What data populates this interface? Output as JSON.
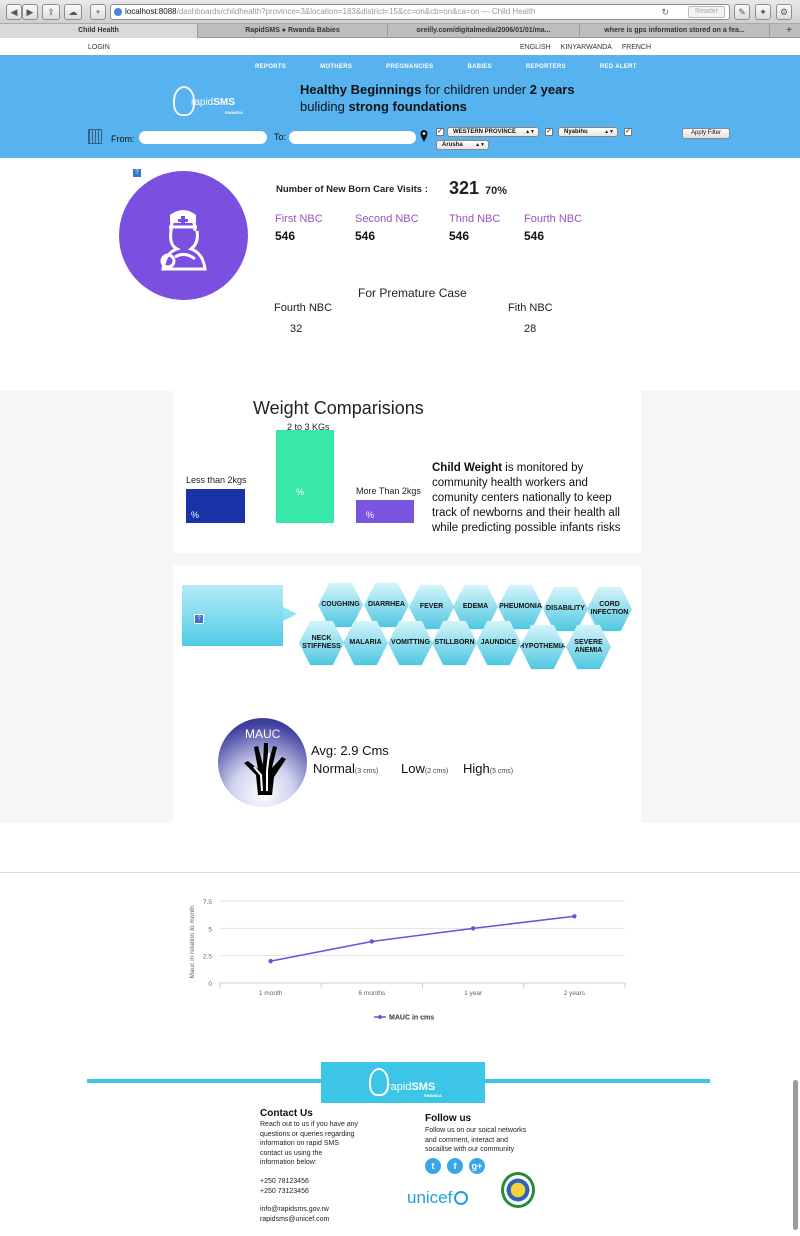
{
  "browser": {
    "url_host": "localhost:8088",
    "url_rest": "/dashboards/childhealth?province=3&location=183&district=15&cc=on&cb=on&ca=on",
    "url_suffix": " — Child Health",
    "reader_label": "Reader",
    "tabs": [
      {
        "label": "Child Health"
      },
      {
        "label": "RapidSMS ● Rwanda Babies"
      },
      {
        "label": "oreilly.com/digitalmedia/2006/01/01/ma..."
      },
      {
        "label": "where is gps information stored on a fea..."
      }
    ]
  },
  "topbar": {
    "login": "LOGIN",
    "languages": [
      "ENGLISH",
      "KINYARWANDA",
      "FRENCH"
    ]
  },
  "nav": {
    "items": [
      "REPORTS",
      "MOTHERS",
      "PREGNANCIES",
      "BABIES",
      "REPORTERS",
      "RED ALERT"
    ]
  },
  "logo": {
    "rapid": "rapid",
    "sms": "SMS",
    "country": "RWANDA"
  },
  "tagline": {
    "line1_bold": "Healthy Beginnings",
    "line1_mid": " for children under ",
    "line1_bold2": "2 years",
    "line2_plain": "buliding ",
    "line2_bold": "strong foundations"
  },
  "filters": {
    "from_label": "From:",
    "to_label": "To:",
    "province": "WESTERN PROVINCE",
    "district": "Nyabihu",
    "sector": "Arusha",
    "apply": "Apply Filter"
  },
  "help_label": "?",
  "nbc": {
    "title": "Number of New Born Care Visits :",
    "count": "321",
    "percent": "70%",
    "visits": [
      {
        "name": "First NBC",
        "value": "546"
      },
      {
        "name": "Second NBC",
        "value": "546"
      },
      {
        "name": "Thrid NBC",
        "value": "546"
      },
      {
        "name": "Fourth NBC",
        "value": "546"
      }
    ],
    "premature_title": "For Premature Case",
    "premature": [
      {
        "name": "Fourth NBC",
        "value": "32"
      },
      {
        "name": "Fith NBC",
        "value": "28"
      }
    ]
  },
  "weight": {
    "title": "Weight Comparisions",
    "bars": [
      {
        "label": "Less than 2kgs",
        "pct": "%",
        "color": "#1a33a8"
      },
      {
        "label": "2 to 3 KGs",
        "pct": "%",
        "color": "#38e8a8"
      },
      {
        "label": "More Than 2kgs",
        "pct": "%",
        "color": "#7a56e0"
      }
    ],
    "desc_bold": "Child Weight",
    "desc_rest": " is monitored by community health workers and comunity centers nationally to keep track of newborns and their health all while predicting possible infants risks"
  },
  "diseases": {
    "items": [
      "COUGHING",
      "DIARRHEA",
      "FEVER",
      "EDEMA",
      "PHEUMONIA",
      "DISABILITY",
      "CORD INFECTION",
      "NECK STIFFNESS",
      "MALARIA",
      "VOMITTING",
      "STILLBORN",
      "JAUNDICE",
      "HYPOTHEMIA",
      "SEVERE ANEMIA"
    ]
  },
  "mauc": {
    "label": "MAUC",
    "avg": "Avg: 2.9 Cms",
    "levels": [
      {
        "name": "Normal",
        "range": "(3 cms)"
      },
      {
        "name": "Low",
        "range": "(2 cms)"
      },
      {
        "name": "High",
        "range": "(5 cms)"
      }
    ]
  },
  "chart_data": {
    "type": "line",
    "categories": [
      "1 month",
      "6 months",
      "1 year",
      "2 years"
    ],
    "series": [
      {
        "name": "MAUC in cms",
        "values": [
          2.0,
          3.8,
          5.0,
          6.1
        ],
        "color": "#6e4fe0"
      }
    ],
    "ylabel": "Mauc in relation to month",
    "yticks": [
      "0",
      "2.5",
      "5",
      "7.5"
    ],
    "ylim": [
      0,
      7.5
    ],
    "grid": true,
    "legend": "bottom"
  },
  "footer": {
    "contact_title": "Contact Us",
    "contact_text": [
      "Reach out to us if you have any",
      "questions or queries regarding",
      "information on rapid SMS",
      "contact us using the",
      "information below:"
    ],
    "phones": [
      "+250 78123456",
      "+250 73123456"
    ],
    "emails": [
      "info@rapidsms.gov.rw",
      "rapidsms@unicef.com"
    ],
    "follow_title": "Follow us",
    "follow_text": [
      "Follow us on our soical networks",
      "and comment, interact and",
      "socailise with our community"
    ],
    "unicef": "unicef"
  }
}
